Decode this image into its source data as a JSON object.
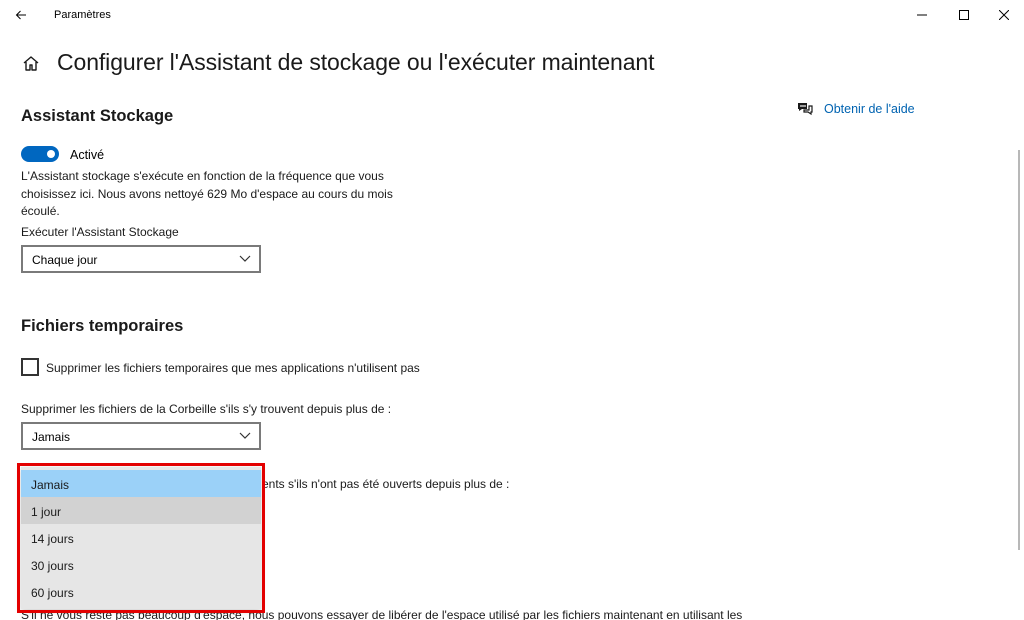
{
  "window": {
    "title": "Paramètres",
    "controls": {
      "minimize": "minimize-icon",
      "maximize": "maximize-icon",
      "close": "close-icon"
    }
  },
  "header": {
    "home_icon": "home-icon",
    "title": "Configurer l'Assistant de stockage ou l'exécuter maintenant"
  },
  "help": {
    "icon": "chat-help-icon",
    "label": "Obtenir de l'aide"
  },
  "storage_sense": {
    "section_title": "Assistant Stockage",
    "toggle_state": true,
    "toggle_label": "Activé",
    "description": "L'Assistant stockage s'exécute en fonction de la fréquence que vous choisissez ici. Nous avons nettoyé 629 Mo d'espace au cours du mois écoulé.",
    "run_label": "Exécuter l'Assistant Stockage",
    "run_value": "Chaque jour"
  },
  "temp_files": {
    "section_title": "Fichiers temporaires",
    "checkbox_checked": false,
    "checkbox_label": "Supprimer les fichiers temporaires que mes applications n'utilisent pas",
    "recycle_label": "Supprimer les fichiers de la Corbeille s'ils s'y trouvent depuis plus de :",
    "recycle_value": "Jamais",
    "downloads_label_partial": "ents s'ils n'ont pas été ouverts depuis plus de :",
    "bottom_text_partial": "S'il ne vous reste pas beaucoup d'espace, nous pouvons essayer de libérer de l'espace utilisé par les fichiers maintenant en utilisant les"
  },
  "dropdown": {
    "options": [
      "Jamais",
      "1 jour",
      "14 jours",
      "30 jours",
      "60 jours"
    ],
    "selected": "Jamais",
    "hovered": "1 jour",
    "highlight_color": "#e30000",
    "selected_color": "#9bd1f8"
  },
  "colors": {
    "accent": "#0067c0",
    "link": "#0063b1"
  }
}
